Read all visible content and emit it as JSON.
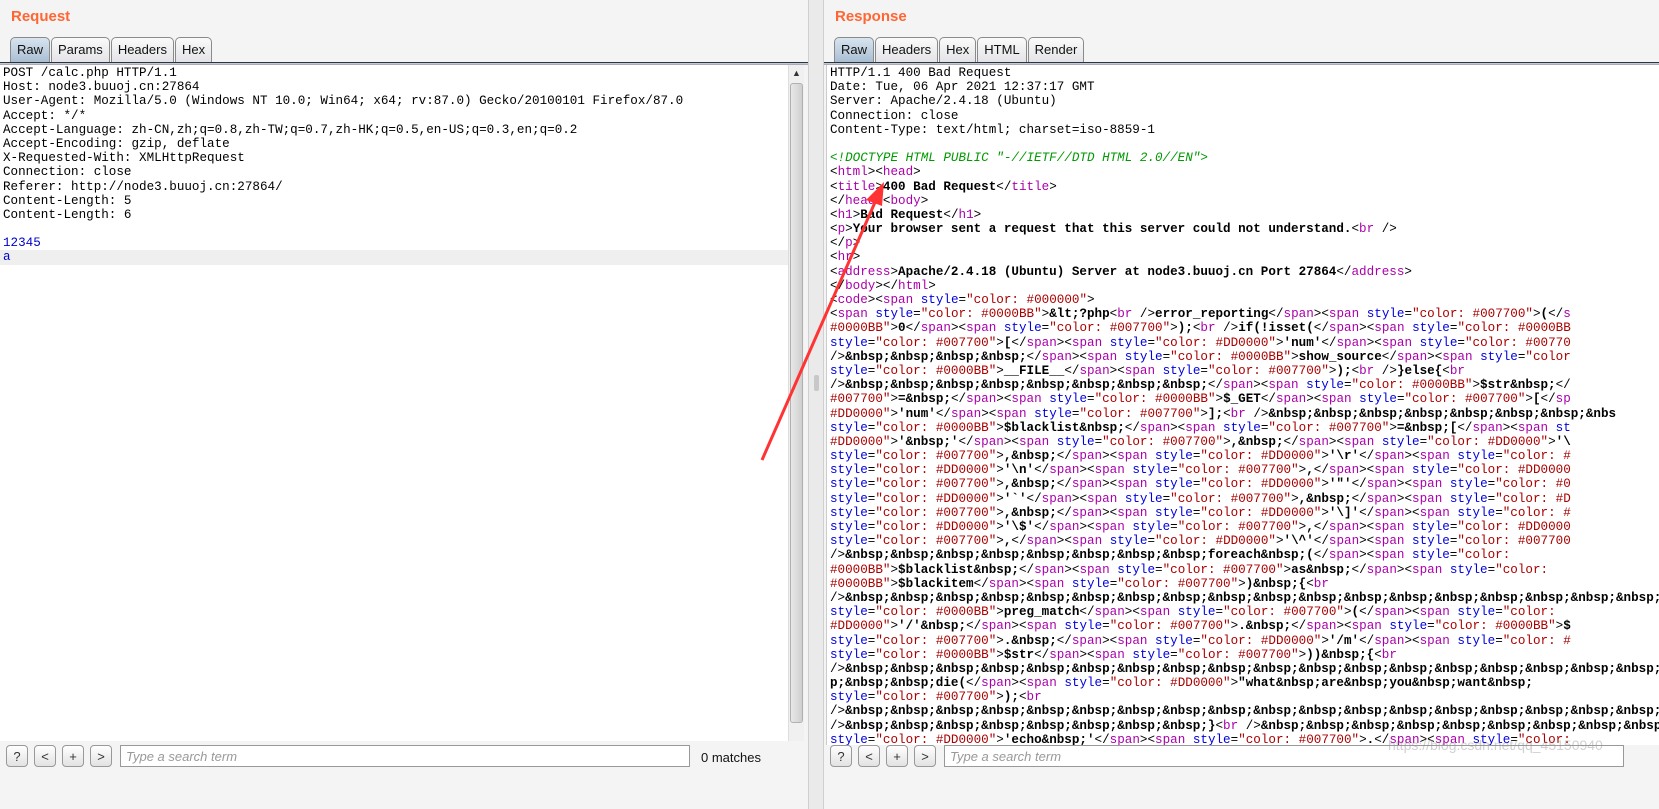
{
  "request": {
    "title": "Request",
    "tabs": [
      "Raw",
      "Params",
      "Headers",
      "Hex"
    ],
    "active_tab": "Raw",
    "headers": [
      "POST /calc.php HTTP/1.1",
      "Host: node3.buuoj.cn:27864",
      "User-Agent: Mozilla/5.0 (Windows NT 10.0; Win64; x64; rv:87.0) Gecko/20100101 Firefox/87.0",
      "Accept: */*",
      "Accept-Language: zh-CN,zh;q=0.8,zh-TW;q=0.7,zh-HK;q=0.5,en-US;q=0.3,en;q=0.2",
      "Accept-Encoding: gzip, deflate",
      "X-Requested-With: XMLHttpRequest",
      "Connection: close",
      "Referer: http://node3.buuoj.cn:27864/",
      "Content-Length: 5",
      "Content-Length: 6"
    ],
    "body": [
      "12345",
      "a"
    ],
    "search": {
      "help": "?",
      "prev": "<",
      "add": "+",
      "next": ">",
      "placeholder": "Type a search term",
      "matches": "0 matches"
    }
  },
  "response": {
    "title": "Response",
    "tabs": [
      "Raw",
      "Headers",
      "Hex",
      "HTML",
      "Render"
    ],
    "active_tab": "Raw",
    "headers": [
      "HTTP/1.1 400 Bad Request",
      "Date: Tue, 06 Apr 2021 12:37:17 GMT",
      "Server: Apache/2.4.18 (Ubuntu)",
      "Connection: close",
      "Content-Type: text/html; charset=iso-8859-1"
    ],
    "doctype": "<!DOCTYPE HTML PUBLIC \"-//IETF//DTD HTML 2.0//EN\">",
    "html_lines": [
      "<html><head>",
      "<title>400 Bad Request</title>",
      "</head><body>",
      "<h1>Bad Request</h1>",
      "<p>Your browser sent a request that this server could not understand.<br />",
      "</p>",
      "<hr>",
      "<address>Apache/2.4.18 (Ubuntu) Server at node3.buuoj.cn Port 27864</address>",
      "</body></html>",
      "<code><span style=\"color: #000000\">",
      "<span style=\"color: #0000BB\">&lt;?php<br />error_reporting</span><span style=\"color: #007700\">(</s",
      "#0000BB\">0</span><span style=\"color: #007700\">);<br />if(!isset(</span><span style=\"color: #0000BB",
      "style=\"color: #007700\">[</span><span style=\"color: #DD0000\">'num'</span><span style=\"color: #00770",
      "/>&nbsp;&nbsp;&nbsp;&nbsp;</span><span style=\"color: #0000BB\">show_source</span><span style=\"color",
      "style=\"color: #0000BB\">__FILE__</span><span style=\"color: #007700\">);<br />}else{<br",
      "/>&nbsp;&nbsp;&nbsp;&nbsp;&nbsp;&nbsp;&nbsp;&nbsp;</span><span style=\"color: #0000BB\">$str&nbsp;</",
      "#007700\">=&nbsp;</span><span style=\"color: #0000BB\">$_GET</span><span style=\"color: #007700\">[</sp",
      "#DD0000\">'num'</span><span style=\"color: #007700\">];<br />&nbsp;&nbsp;&nbsp;&nbsp;&nbsp;&nbsp;&nbsp;&nbs",
      "style=\"color: #0000BB\">$blacklist&nbsp;</span><span style=\"color: #007700\">=&nbsp;[</span><span st",
      "#DD0000\">'&nbsp;'</span><span style=\"color: #007700\">,&nbsp;</span><span style=\"color: #DD0000\">'\\",
      "style=\"color: #007700\">,&nbsp;</span><span style=\"color: #DD0000\">'\\r'</span><span style=\"color: #",
      "style=\"color: #DD0000\">'\\n'</span><span style=\"color: #007700\">,</span><span style=\"color: #DD0000",
      "style=\"color: #007700\">,&nbsp;</span><span style=\"color: #DD0000\">'\"'</span><span style=\"color: #0",
      "style=\"color: #DD0000\">'`'</span><span style=\"color: #007700\">,&nbsp;</span><span style=\"color: #D",
      "style=\"color: #007700\">,&nbsp;</span><span style=\"color: #DD0000\">'\\]'</span><span style=\"color: #",
      "style=\"color: #DD0000\">'\\$'</span><span style=\"color: #007700\">,</span><span style=\"color: #DD0000",
      "style=\"color: #007700\">,</span><span style=\"color: #DD0000\">'\\^'</span><span style=\"color: #007700",
      "/>&nbsp;&nbsp;&nbsp;&nbsp;&nbsp;&nbsp;&nbsp;&nbsp;foreach&nbsp;(</span><span style=\"color:",
      "#0000BB\">$blacklist&nbsp;</span><span style=\"color: #007700\">as&nbsp;</span><span style=\"color:",
      "#0000BB\">$blackitem</span><span style=\"color: #007700\">)&nbsp;{<br",
      "/>&nbsp;&nbsp;&nbsp;&nbsp;&nbsp;&nbsp;&nbsp;&nbsp;&nbsp;&nbsp;&nbsp;&nbsp;&nbsp;&nbsp;&nbsp;&nbsp;&nbsp;&nbsp;&nbsp;&nbsp;&nbsp;",
      "style=\"color: #0000BB\">preg_match</span><span style=\"color: #007700\">(</span><span style=\"color:",
      "#DD0000\">'/'&nbsp;</span><span style=\"color: #007700\">.&nbsp;</span><span style=\"color: #0000BB\">$",
      "style=\"color: #007700\">.&nbsp;</span><span style=\"color: #DD0000\">'/m'</span><span style=\"color: #",
      "style=\"color: #0000BB\">$str</span><span style=\"color: #007700\">))&nbsp;{<br",
      "/>&nbsp;&nbsp;&nbsp;&nbsp;&nbsp;&nbsp;&nbsp;&nbsp;&nbsp;&nbsp;&nbsp;&nbsp;&nbsp;&nbsp;&nbsp;&nbsp;&nbsp;&nbsp;&nbsp;&nbsp;&nbsp;",
      "p;&nbsp;&nbsp;die(</span><span style=\"color: #DD0000\">\"what&nbsp;are&nbsp;you&nbsp;want&nbsp;",
      "style=\"color: #007700\">);<br",
      "/>&nbsp;&nbsp;&nbsp;&nbsp;&nbsp;&nbsp;&nbsp;&nbsp;&nbsp;&nbsp;&nbsp;&nbsp;&nbsp;&nbsp;&nbsp;&nbsp;&nbsp;&nbsp;&nbsp;&nbsp;&nbsp;",
      "/>&nbsp;&nbsp;&nbsp;&nbsp;&nbsp;&nbsp;&nbsp;&nbsp;}<br />&nbsp;&nbsp;&nbsp;&nbsp;&nbsp;&nbsp;&nbsp;&nbsp;&nbsp;",
      "style=\"color: #DD0000\">'echo&nbsp;'</span><span style=\"color: #007700\">.</span><span style=\"color: "
    ],
    "search": {
      "help": "?",
      "prev": "<",
      "add": "+",
      "next": ">",
      "placeholder": "Type a search term"
    }
  },
  "watermark": "https://blog.csdn.net/qq_45150940",
  "colors": {
    "title": "#ff6633",
    "annotation_arrow": "#ff3333"
  }
}
